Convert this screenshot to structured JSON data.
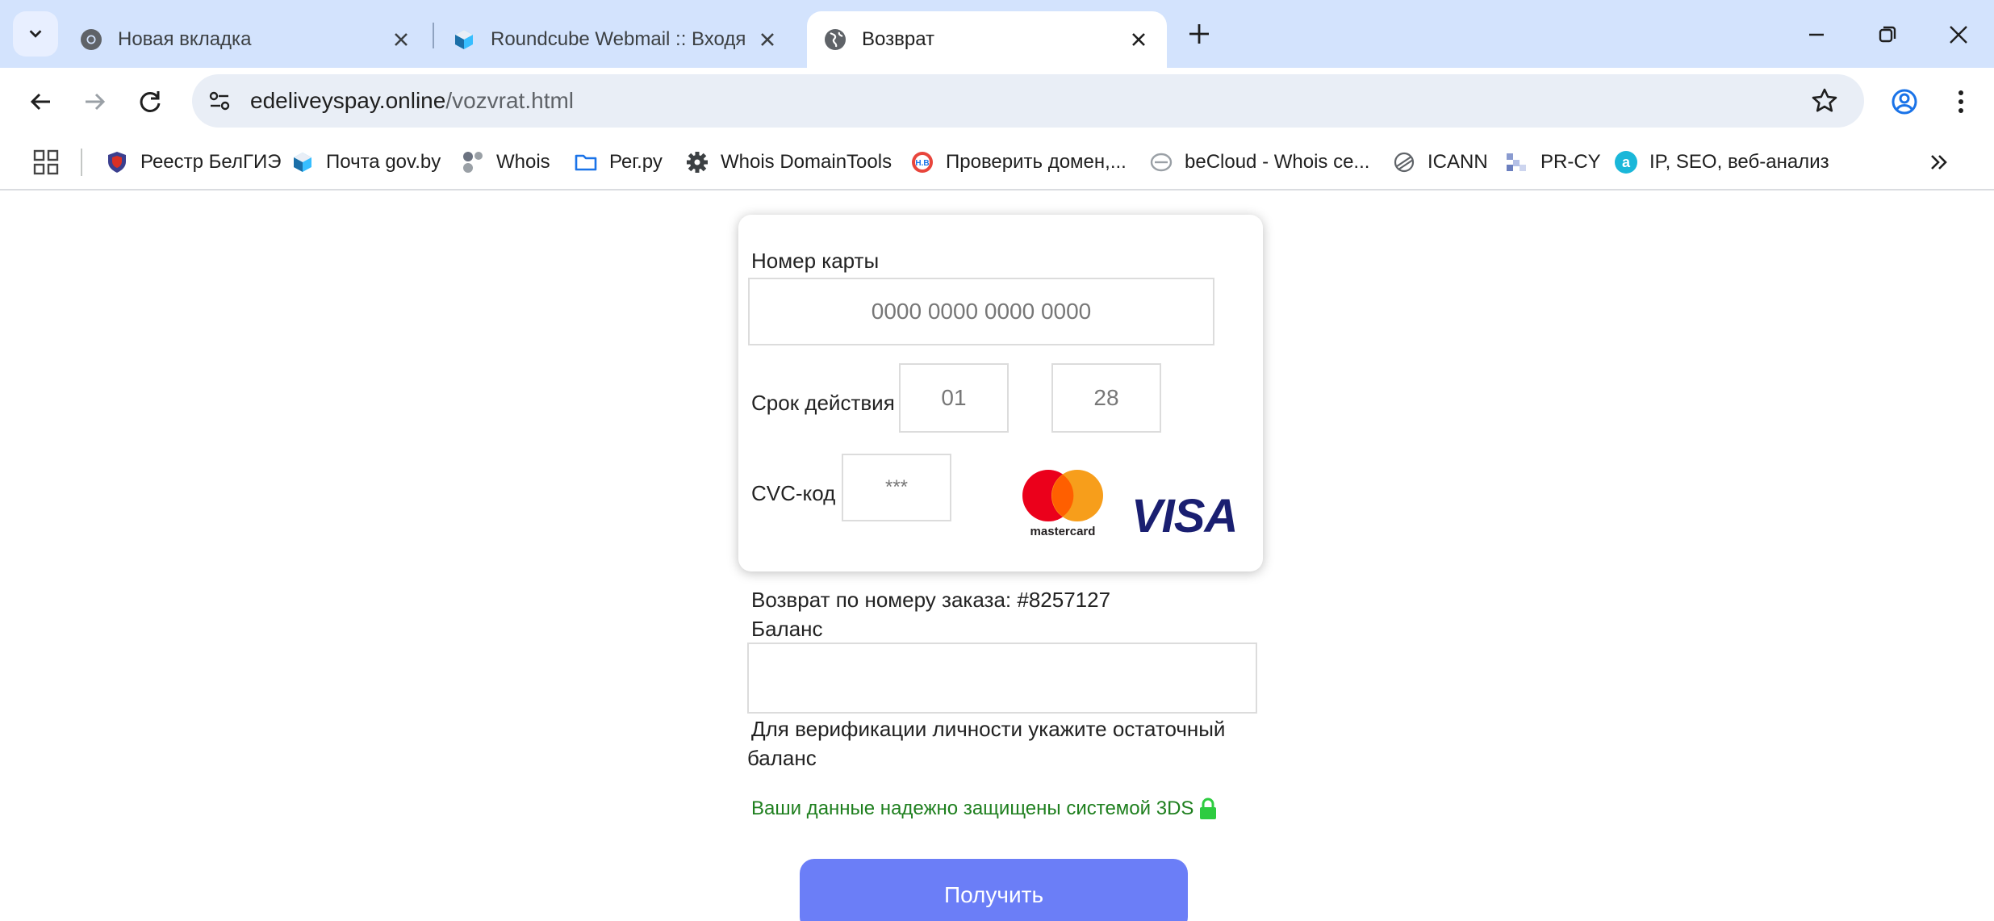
{
  "browser": {
    "tabs": [
      {
        "title": "Новая вкладка",
        "icon": "chrome-icon",
        "active": false
      },
      {
        "title": "Roundcube Webmail :: Входящие",
        "icon": "roundcube-icon",
        "active": false
      },
      {
        "title": "Возврат",
        "icon": "globe-icon",
        "active": true
      }
    ],
    "address": {
      "domain": "edeliveyspay.online",
      "path": "/vozvrat.html"
    },
    "bookmarks": [
      {
        "label": "Реестр БелГИЭ",
        "icon": "shield-icon"
      },
      {
        "label": "Почта gov.by",
        "icon": "roundcube-icon"
      },
      {
        "label": "Whois",
        "icon": "whois-icon"
      },
      {
        "label": "Рег.ру",
        "icon": "folder-icon"
      },
      {
        "label": "Whois DomainTools",
        "icon": "gear-icon"
      },
      {
        "label": "Проверить домен,...",
        "icon": "hb-icon"
      },
      {
        "label": "beCloud - Whois се...",
        "icon": "becloud-icon"
      },
      {
        "label": "ICANN",
        "icon": "icann-icon"
      },
      {
        "label": "PR-CY",
        "icon": "prcy-icon"
      },
      {
        "label": "IP, SEO, веб-анализ",
        "icon": "a-icon"
      }
    ]
  },
  "form": {
    "card_number_label": "Номер карты",
    "card_number_placeholder": "0000 0000 0000 0000",
    "expiry_label": "Срок действия",
    "expiry_month_placeholder": "01",
    "expiry_year_placeholder": "28",
    "cvc_label": "CVC-код",
    "cvc_placeholder": "***",
    "mastercard_text": "mastercard",
    "visa_text": "VISA",
    "order_text": "Возврат по номеру заказа: #8257127",
    "balance_label": "Баланс",
    "hint_line1": "Для верификации личности укажите остаточный",
    "hint_line2": "баланс",
    "secure_text": "Ваши данные надежно защищены системой 3DS",
    "submit_label": "Получить"
  },
  "colors": {
    "chrome_bg": "#d3e3fd",
    "button": "#6b7ef7",
    "secure_text": "#1e7f1e",
    "mastercard_red": "#eb001b",
    "mastercard_orange": "#f79e1b",
    "visa_blue": "#1a1f71"
  }
}
